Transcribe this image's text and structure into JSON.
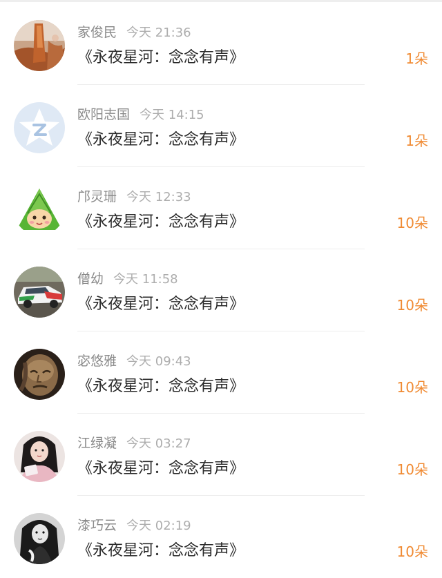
{
  "gifts": [
    {
      "name": "家俊民",
      "time": "今天 21:36",
      "title": "《永夜星河：念念有声》",
      "count": "1朵",
      "avatar": "person-orange-avatar"
    },
    {
      "name": "欧阳志国",
      "time": "今天 14:15",
      "title": "《永夜星河：念念有声》",
      "count": "1朵",
      "avatar": "default-star-avatar"
    },
    {
      "name": "邝灵珊",
      "time": "今天 12:33",
      "title": "《永夜星河：念念有声》",
      "count": "10朵",
      "avatar": "zongzi-avatar"
    },
    {
      "name": "僧幼",
      "time": "今天 11:58",
      "title": "《永夜星河：念念有声》",
      "count": "10朵",
      "avatar": "racing-car-avatar"
    },
    {
      "name": "宓悠雅",
      "time": "今天 09:43",
      "title": "《永夜星河：念念有声》",
      "count": "10朵",
      "avatar": "sculpture-face-avatar"
    },
    {
      "name": "江绿凝",
      "time": "今天 03:27",
      "title": "《永夜星河：念念有声》",
      "count": "10朵",
      "avatar": "girl-photo-avatar"
    },
    {
      "name": "漆巧云",
      "time": "今天 02:19",
      "title": "《永夜星河：念念有声》",
      "count": "10朵",
      "avatar": "bw-portrait-avatar"
    }
  ],
  "colors": {
    "accent": "#f08a32",
    "name": "#8a8a8a",
    "time": "#adadad",
    "title": "#2a2a2a"
  }
}
